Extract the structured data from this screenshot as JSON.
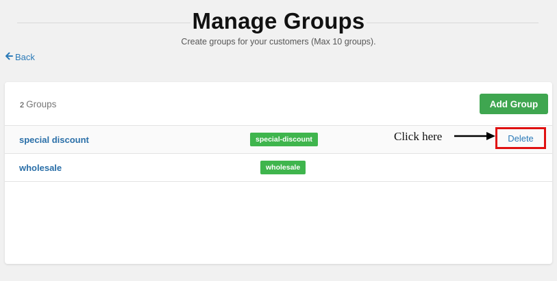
{
  "header": {
    "title": "Manage Groups",
    "subtitle": "Create groups for your customers (Max 10 groups)."
  },
  "nav": {
    "back_label": "Back"
  },
  "card": {
    "group_count_number": "2",
    "group_count_label": "Groups",
    "add_group_label": "Add Group",
    "rows": [
      {
        "name": "special discount",
        "tag": "special-discount",
        "delete_label": "Delete"
      },
      {
        "name": "wholesale",
        "tag": "wholesale"
      }
    ]
  },
  "annotation": {
    "hint_text": "Click here"
  },
  "colors": {
    "accent_green": "#3fa650",
    "tag_green": "#3fb54d",
    "link_blue": "#2a7ab8",
    "highlight_red": "#e01010"
  },
  "icons": {
    "back": "arrow-left-icon",
    "pointer": "arrow-right-icon"
  }
}
